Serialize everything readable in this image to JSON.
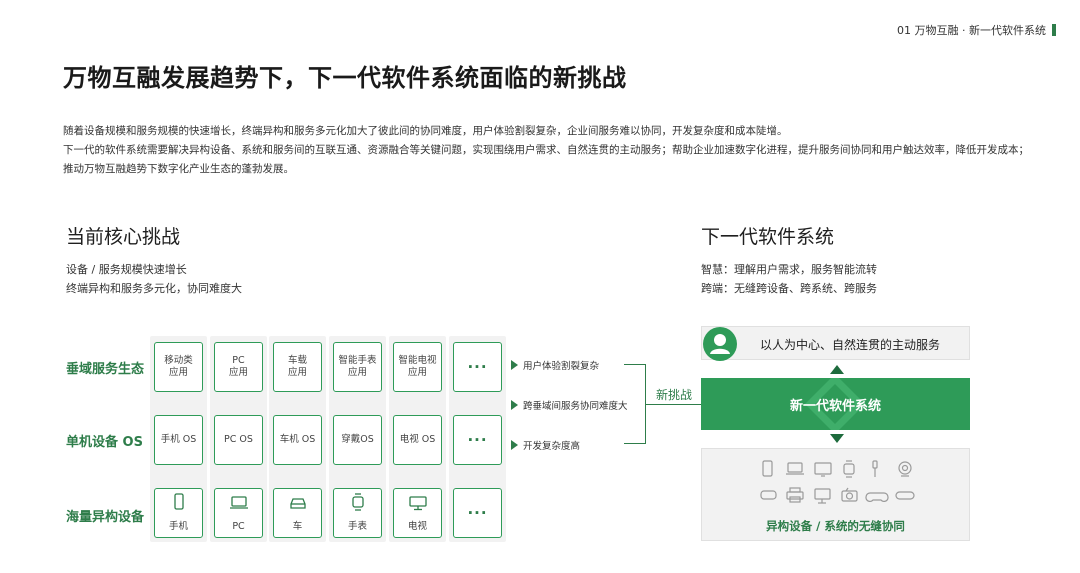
{
  "header": {
    "breadcrumb": "01 万物互融 · 新一代软件系统"
  },
  "title": "万物互融发展趋势下，下一代软件系统面临的新挑战",
  "description": [
    "随着设备规模和服务规模的快速增长，终端异构和服务多元化加大了彼此间的协同难度，用户体验割裂复杂，企业间服务难以协同，开发复杂度和成本陡增。",
    "下一代的软件系统需要解决异构设备、系统和服务间的互联互通、资源融合等关键问题，实现围绕用户需求、自然连贯的主动服务；帮助企业加速数字化进程，提升服务间协同和用户触达效率，降低开发成本；推动万物互融趋势下数字化产业生态的蓬勃发展。"
  ],
  "left": {
    "heading": "当前核心挑战",
    "points": [
      "设备 / 服务规模快速增长",
      "终端异构和服务多元化，协同难度大"
    ],
    "rows": [
      "垂域服务生态",
      "单机设备 OS",
      "海量异构设备"
    ],
    "columns": [
      {
        "app": "移动类\n应用",
        "os": "手机 OS",
        "device": "手机",
        "device_icon": "phone-icon"
      },
      {
        "app": "PC\n应用",
        "os": "PC OS",
        "device": "PC",
        "device_icon": "laptop-icon"
      },
      {
        "app": "车载\n应用",
        "os": "车机 OS",
        "device": "车",
        "device_icon": "car-icon"
      },
      {
        "app": "智能手表\n应用",
        "os": "穿戴OS",
        "device": "手表",
        "device_icon": "watch-icon"
      },
      {
        "app": "智能电视\n应用",
        "os": "电视 OS",
        "device": "电视",
        "device_icon": "tv-icon"
      },
      {
        "app": "···",
        "os": "···",
        "device": "···",
        "device_icon": "more-icon"
      }
    ],
    "issues": [
      "用户体验割裂复杂",
      "跨垂域间服务协同难度大",
      "开发复杂度高"
    ],
    "new_challenge": "新挑战"
  },
  "right": {
    "heading": "下一代软件系统",
    "points": [
      "智慧：理解用户需求，服务智能流转",
      "跨端：无缝跨设备、跨系统、跨服务"
    ],
    "center_label": "以人为中心、自然连贯的主动服务",
    "system_label": "新一代软件系统",
    "device_label": "异构设备 / 系统的无缝协同"
  },
  "colors": {
    "accent": "#2e9b58",
    "accent_dark": "#2e7d4a",
    "panel": "#f2f2f2"
  }
}
